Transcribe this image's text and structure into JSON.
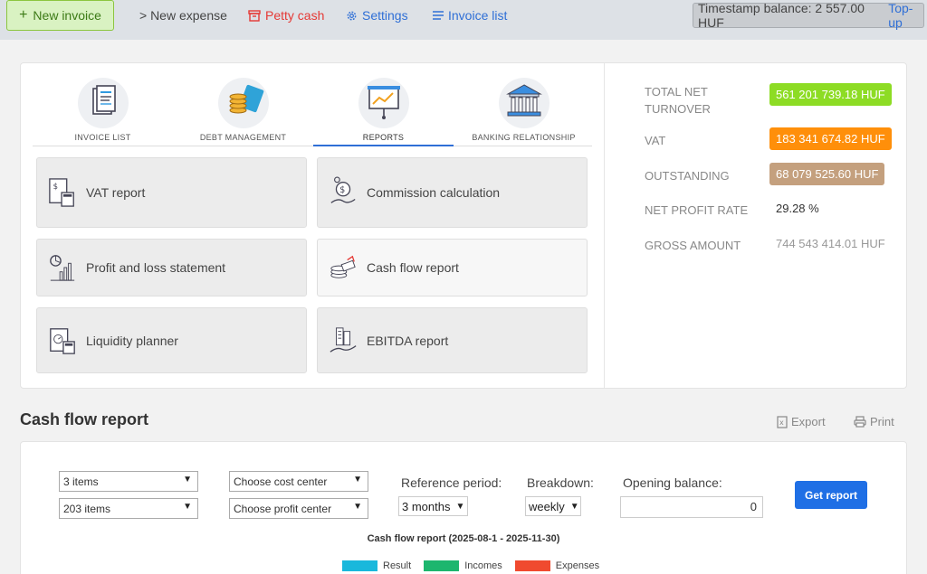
{
  "topbar": {
    "new_invoice": "New invoice",
    "new_expense": "> New expense",
    "petty_cash": "Petty cash",
    "settings": "Settings",
    "invoice_list": "Invoice list",
    "timestamp_balance": "Timestamp balance: 2 557.00 HUF",
    "topup": "Top-up"
  },
  "tabs": [
    {
      "label": "INVOICE LIST",
      "icon": "invoice-list-icon"
    },
    {
      "label": "DEBT MANAGEMENT",
      "icon": "debt-management-icon"
    },
    {
      "label": "REPORTS",
      "icon": "reports-icon",
      "active": true
    },
    {
      "label": "BANKING RELATIONSHIP",
      "icon": "bank-icon"
    }
  ],
  "tiles": [
    {
      "label": "VAT report",
      "icon": "vat-report-icon"
    },
    {
      "label": "Commission calculation",
      "icon": "commission-icon"
    },
    {
      "label": "Profit and loss statement",
      "icon": "profit-loss-icon"
    },
    {
      "label": "Cash flow report",
      "icon": "cash-flow-icon"
    },
    {
      "label": "Liquidity planner",
      "icon": "liquidity-icon"
    },
    {
      "label": "EBITDA report",
      "icon": "ebitda-icon"
    }
  ],
  "stats": {
    "total_net_label": "TOTAL NET TURNOVER",
    "total_net_value": "561 201 739.18 HUF",
    "vat_label": "VAT",
    "vat_value": "183 341 674.82 HUF",
    "outstanding_label": "OUTSTANDING",
    "outstanding_value": "68 079 525.60 HUF",
    "net_profit_label": "NET PROFIT RATE",
    "net_profit_value": "29.28 %",
    "gross_label": "GROSS AMOUNT",
    "gross_value": "744 543 414.01 HUF"
  },
  "colors": {
    "accent": "#1f6fe5",
    "total_net": "#8ddc24",
    "vat": "#ff8f0a",
    "outstanding": "#c4a07e",
    "result": "#19b8dc",
    "incomes": "#1db66e",
    "expenses": "#f04a2f"
  },
  "report": {
    "title": "Cash flow report",
    "export": "Export",
    "print": "Print",
    "items_select": "3 items",
    "items_select2": "203 items",
    "cost_center": "Choose cost center",
    "profit_center": "Choose profit center",
    "reference_period_label": "Reference period:",
    "reference_period": "3 months",
    "breakdown_label": "Breakdown:",
    "breakdown": "weekly",
    "opening_balance_label": "Opening balance:",
    "opening_balance": "0",
    "get_report": "Get report",
    "chart_title": "Cash flow report (2025-08-1 - 2025-11-30)",
    "legend": [
      "Result",
      "Incomes",
      "Expenses"
    ]
  }
}
